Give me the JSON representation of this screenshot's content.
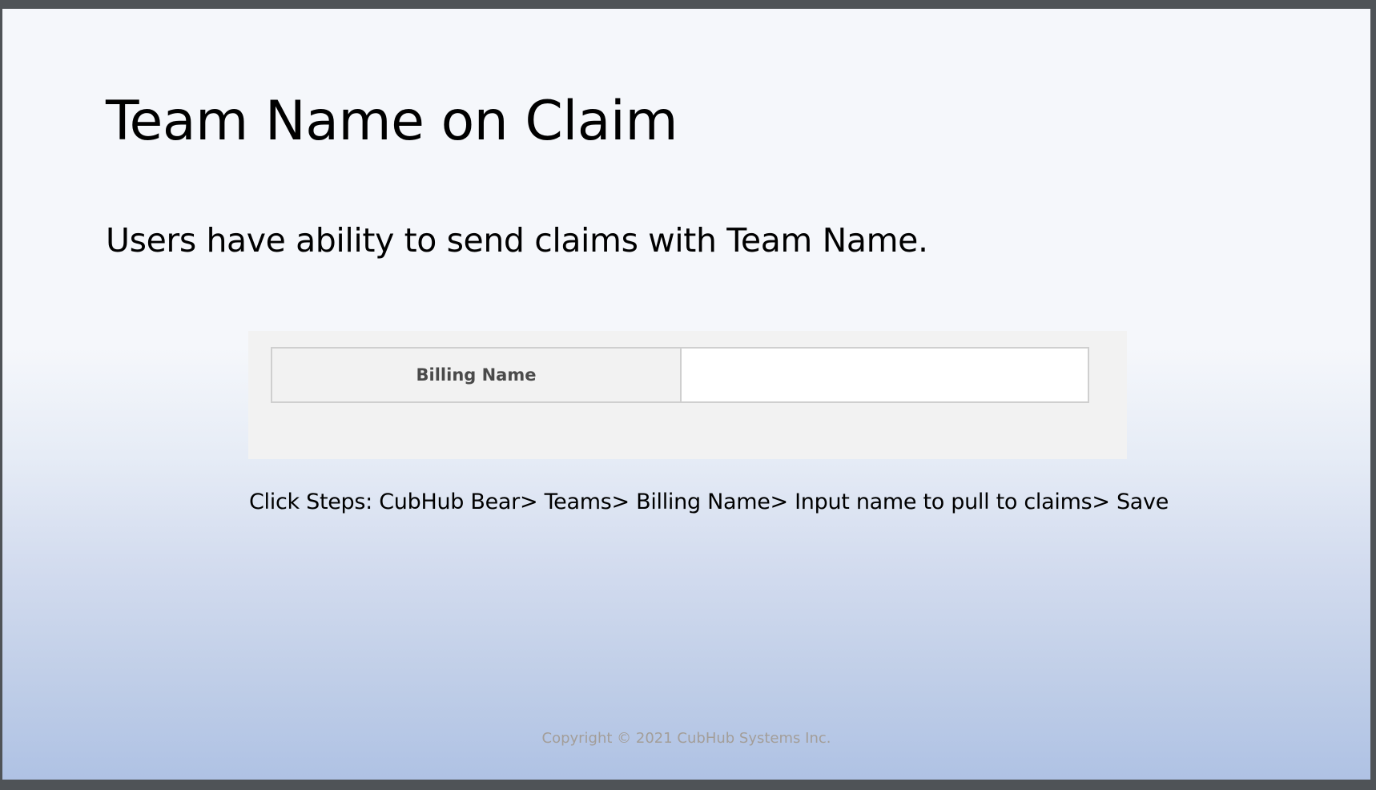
{
  "slide": {
    "title": "Team Name on Claim",
    "subtitle": "Users have ability to send claims with Team Name.",
    "form": {
      "billing_name_label": "Billing Name",
      "billing_name_value": ""
    },
    "click_steps": "Click Steps: CubHub Bear> Teams> Billing Name> Input name to pull to claims> Save",
    "copyright": "Copyright © 2021 CubHub Systems Inc."
  },
  "colors": {
    "background_top": "#f5f7fb",
    "background_bottom": "#afc2e4",
    "panel": "#f2f2f2",
    "label_text": "#4a4a4a",
    "copyright_text": "#a39e99"
  }
}
